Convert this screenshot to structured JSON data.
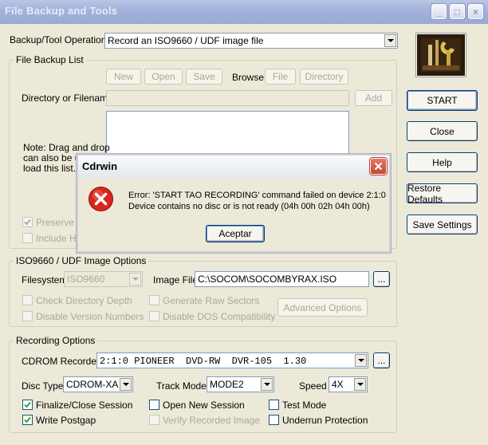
{
  "window": {
    "title": "File Backup and Tools",
    "minimize": "_",
    "maximize": "□",
    "close": "×"
  },
  "operation": {
    "label": "Backup/Tool Operation",
    "value": "Record an ISO9660 / UDF image file"
  },
  "side_buttons": {
    "start": "START",
    "close": "Close",
    "help": "Help",
    "restore": "Restore Defaults",
    "save": "Save Settings"
  },
  "backup_list": {
    "group_title": "File Backup List",
    "new": "New",
    "open": "Open",
    "save": "Save",
    "browse": "Browse",
    "file": "File",
    "directory": "Directory",
    "dir_label": "Directory or Filename",
    "add": "Add",
    "note_line1": "Note: Drag and drop",
    "note_line2": "can also be us",
    "note_line3": "load this list.",
    "preserve": "Preserve F",
    "include": "Include Hi"
  },
  "iso_options": {
    "group_title": "ISO9660 / UDF Image Options",
    "filesystem_label": "Filesystem",
    "filesystem_value": "ISO9660",
    "image_file_label": "Image File",
    "image_file_value": "C:\\SOCOM\\SOCOMBYRAX.ISO",
    "browse_btn": "...",
    "check_depth": "Check Directory Depth",
    "raw_sectors": "Generate Raw Sectors",
    "advanced": "Advanced Options",
    "disable_version": "Disable Version Numbers",
    "disable_dos": "Disable DOS Compatibility"
  },
  "recording": {
    "group_title": "Recording Options",
    "recorder_label": "CDROM Recorder",
    "recorder_value": "2:1:0 PIONEER  DVD-RW  DVR-105  1.30",
    "browse_btn": "...",
    "disc_type_label": "Disc Type",
    "disc_type_value": "CDROM-XA",
    "track_mode_label": "Track Mode",
    "track_mode_value": "MODE2",
    "speed_label": "Speed",
    "speed_value": "4X",
    "finalize": "Finalize/Close Session",
    "open_new": "Open New Session",
    "test_mode": "Test Mode",
    "write_postgap": "Write Postgap",
    "verify": "Verify Recorded Image",
    "underrun": "Underrun Protection"
  },
  "dialog": {
    "title": "Cdrwin",
    "line1": "Error: 'START TAO RECORDING' command failed on device 2:1:0",
    "line2": "Device contains no disc or is not ready (04h 00h 02h 04h 00h)",
    "ok": "Aceptar"
  }
}
